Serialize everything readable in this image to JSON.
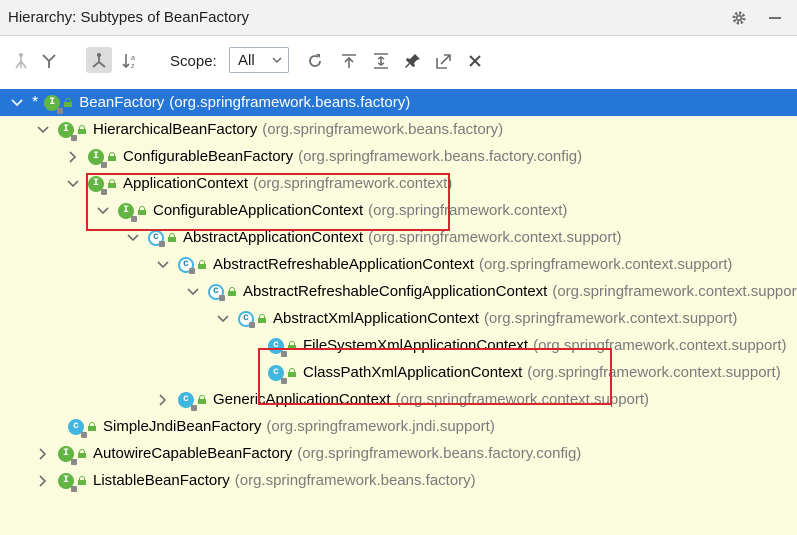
{
  "window": {
    "title": "Hierarchy: Subtypes of BeanFactory"
  },
  "toolbar": {
    "icons": [
      "supertypes-hierarchy-icon",
      "merge-icon",
      "subtypes-hierarchy-icon",
      "sort-alphabetically-icon",
      "refresh-icon",
      "expand-all-icon",
      "collapse-all-icon",
      "pin-icon",
      "export-icon",
      "close-icon"
    ],
    "scope_label": "Scope:",
    "scope_value": "All"
  },
  "tree": {
    "rows": [
      {
        "name": "BeanFactory",
        "pkg": "(org.springframework.beans.factory)",
        "kind": "interface",
        "marker": "*"
      },
      {
        "name": "HierarchicalBeanFactory",
        "pkg": "(org.springframework.beans.factory)",
        "kind": "interface"
      },
      {
        "name": "ConfigurableBeanFactory",
        "pkg": "(org.springframework.beans.factory.config)",
        "kind": "interface"
      },
      {
        "name": "ApplicationContext",
        "pkg": "(org.springframework.context)",
        "kind": "interface"
      },
      {
        "name": "ConfigurableApplicationContext",
        "pkg": "(org.springframework.context)",
        "kind": "interface"
      },
      {
        "name": "AbstractApplicationContext",
        "pkg": "(org.springframework.context.support)",
        "kind": "abstract-class"
      },
      {
        "name": "AbstractRefreshableApplicationContext",
        "pkg": "(org.springframework.context.support)",
        "kind": "abstract-class"
      },
      {
        "name": "AbstractRefreshableConfigApplicationContext",
        "pkg": "(org.springframework.context.support)",
        "kind": "abstract-class"
      },
      {
        "name": "AbstractXmlApplicationContext",
        "pkg": "(org.springframework.context.support)",
        "kind": "abstract-class"
      },
      {
        "name": "FileSystemXmlApplicationContext",
        "pkg": "(org.springframework.context.support)",
        "kind": "class"
      },
      {
        "name": "ClassPathXmlApplicationContext",
        "pkg": "(org.springframework.context.support)",
        "kind": "class"
      },
      {
        "name": "GenericApplicationContext",
        "pkg": "(org.springframework.context.support)",
        "kind": "class"
      },
      {
        "name": "SimpleJndiBeanFactory",
        "pkg": "(org.springframework.jndi.support)",
        "kind": "class"
      },
      {
        "name": "AutowireCapableBeanFactory",
        "pkg": "(org.springframework.beans.factory.config)",
        "kind": "interface"
      },
      {
        "name": "ListableBeanFactory",
        "pkg": "(org.springframework.beans.factory)",
        "kind": "interface"
      }
    ]
  },
  "colors": {
    "selection": "#2676d8",
    "tree_bg": "#fbfcde",
    "highlight_box": "#d9262c",
    "interface_icon": "#62b543",
    "class_icon": "#40b6e0"
  }
}
